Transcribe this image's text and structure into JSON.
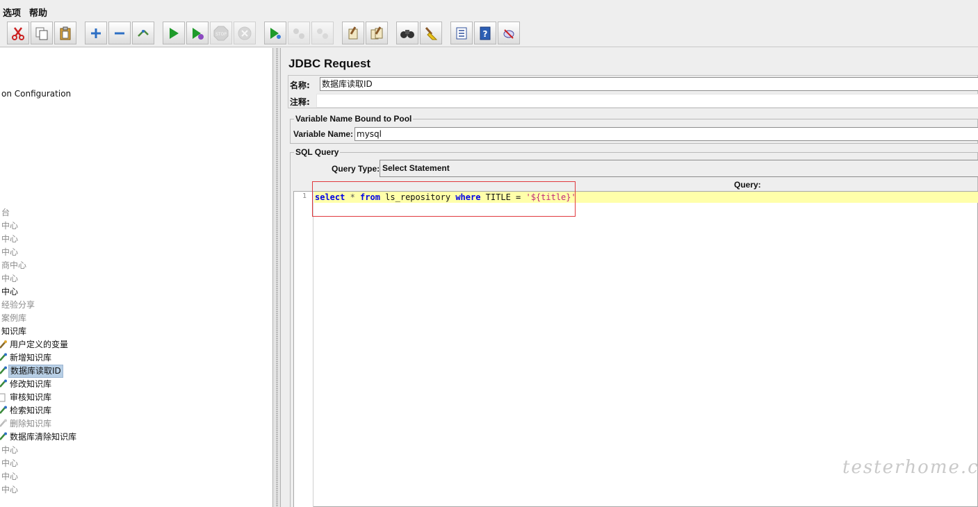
{
  "menu": {
    "options": "选项",
    "help": "帮助"
  },
  "toolbar": {
    "buttons": [
      {
        "name": "cut-icon"
      },
      {
        "name": "copy-icon"
      },
      {
        "name": "paste-icon"
      },
      {
        "name": "expand-icon"
      },
      {
        "name": "collapse-icon"
      },
      {
        "name": "toggle-icon"
      },
      {
        "name": "start-icon"
      },
      {
        "name": "start-no-pauses-icon"
      },
      {
        "name": "stop-icon"
      },
      {
        "name": "shutdown-icon"
      },
      {
        "name": "remote-start-icon"
      },
      {
        "name": "remote-stop-icon"
      },
      {
        "name": "remote-shutdown-icon"
      },
      {
        "name": "clear-icon"
      },
      {
        "name": "clear-all-icon"
      },
      {
        "name": "search-icon"
      },
      {
        "name": "reset-search-icon"
      },
      {
        "name": "function-helper-icon"
      },
      {
        "name": "help-icon"
      },
      {
        "name": "log-viewer-icon"
      }
    ]
  },
  "tree": {
    "items": [
      {
        "label": "on Configuration",
        "style": "plain"
      },
      {
        "label": "台",
        "style": "dim"
      },
      {
        "label": "中心",
        "style": "dim"
      },
      {
        "label": "中心",
        "style": "dim"
      },
      {
        "label": "中心",
        "style": "dim"
      },
      {
        "label": "商中心",
        "style": "dim"
      },
      {
        "label": "中心",
        "style": "dim"
      },
      {
        "label": "中心",
        "style": "plain"
      },
      {
        "label": "经验分享",
        "style": "dim"
      },
      {
        "label": "案例库",
        "style": "dim"
      },
      {
        "label": "知识库",
        "style": "plain"
      },
      {
        "label": "用户定义的变量",
        "style": "child"
      },
      {
        "label": "新增知识库",
        "style": "child"
      },
      {
        "label": "数据库读取ID",
        "style": "child-selected"
      },
      {
        "label": "修改知识库",
        "style": "child"
      },
      {
        "label": "审核知识库",
        "style": "child"
      },
      {
        "label": "检索知识库",
        "style": "child"
      },
      {
        "label": "删除知识库",
        "style": "child-dim"
      },
      {
        "label": "数据库清除知识库",
        "style": "child"
      },
      {
        "label": "中心",
        "style": "dim"
      },
      {
        "label": "中心",
        "style": "dim"
      },
      {
        "label": "中心",
        "style": "dim"
      },
      {
        "label": "中心",
        "style": "dim"
      }
    ]
  },
  "panel": {
    "title": "JDBC Request",
    "name_label": "名称:",
    "name_value": "数据库读取ID",
    "comment_label": "注释:",
    "comment_value": "",
    "pool_group_title": "Variable Name Bound to Pool",
    "variable_name_label": "Variable Name:",
    "variable_name_value": "mysql",
    "sql_group_title": "SQL Query",
    "query_type_label": "Query Type:",
    "query_type_value": "Select Statement",
    "query_header": "Query:",
    "editor": {
      "line_number": "1",
      "tokens": {
        "t1": "select",
        "t2": " * ",
        "t3": "from",
        "t4": " ls_repository ",
        "t5": "where",
        "t6": " TITLE = ",
        "t7": "'${title}'"
      }
    }
  },
  "watermark": "testerhome.com",
  "colors": {
    "highlight": "#ffffaa",
    "keyword": "#0000e6",
    "string": "#c0297a",
    "annotation": "#e0383d",
    "selection": "#b8cfe5"
  }
}
